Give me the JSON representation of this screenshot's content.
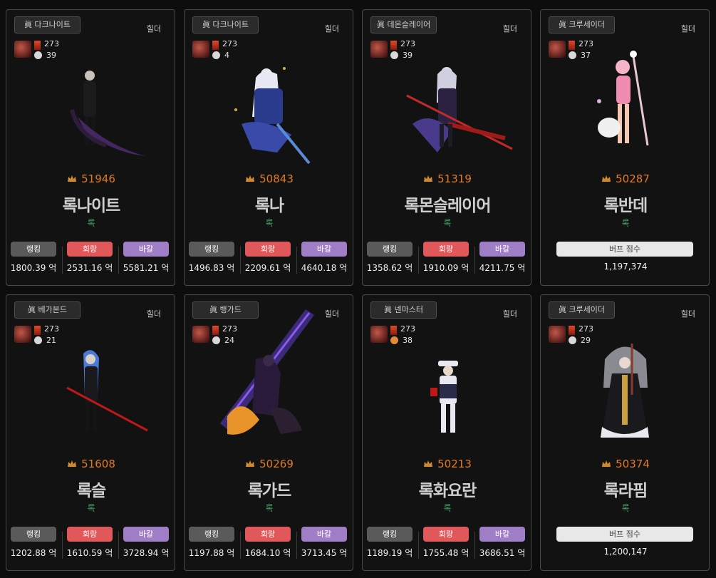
{
  "cards": [
    {
      "job": "眞 다크나이트",
      "server": "힐더",
      "level": "273",
      "sub": "39",
      "power": "51946",
      "name": "록나이트",
      "guild": "록",
      "type": "stat",
      "ranking": "1800.39 억",
      "hoeryang": "2531.16 억",
      "barkal": "5581.21 억"
    },
    {
      "job": "眞 다크나이트",
      "server": "힐더",
      "level": "273",
      "sub": "4",
      "power": "50843",
      "name": "록나",
      "guild": "록",
      "type": "stat",
      "ranking": "1496.83 억",
      "hoeryang": "2209.61 억",
      "barkal": "4640.18 억"
    },
    {
      "job": "眞 데몬슬레이어",
      "server": "힐더",
      "level": "273",
      "sub": "39",
      "power": "51319",
      "name": "록몬슬레이어",
      "guild": "록",
      "type": "stat",
      "ranking": "1358.62 억",
      "hoeryang": "1910.09 억",
      "barkal": "4211.75 억"
    },
    {
      "job": "眞 크루세이더",
      "server": "힐더",
      "level": "273",
      "sub": "37",
      "power": "50287",
      "name": "록반데",
      "guild": "록",
      "type": "buff",
      "buff_score": "1,197,374"
    },
    {
      "job": "眞 베가본드",
      "server": "힐더",
      "level": "273",
      "sub": "21",
      "power": "51608",
      "name": "록슬",
      "guild": "록",
      "type": "stat",
      "ranking": "1202.88 억",
      "hoeryang": "1610.59 억",
      "barkal": "3728.94 억"
    },
    {
      "job": "眞 뱅가드",
      "server": "힐더",
      "level": "273",
      "sub": "24",
      "power": "50269",
      "name": "록가드",
      "guild": "록",
      "type": "stat",
      "ranking": "1197.88 억",
      "hoeryang": "1684.10 억",
      "barkal": "3713.45 억"
    },
    {
      "job": "眞 넨마스터",
      "server": "힐더",
      "level": "273",
      "sub": "38",
      "power": "50213",
      "name": "록화요란",
      "guild": "록",
      "type": "stat",
      "ranking": "1189.19 억",
      "hoeryang": "1755.48 억",
      "barkal": "3686.51 억"
    },
    {
      "job": "眞 크루세이더",
      "server": "힐더",
      "level": "273",
      "sub": "29",
      "power": "50374",
      "name": "록라핌",
      "guild": "록",
      "type": "buff",
      "buff_score": "1,200,147"
    }
  ],
  "labels": {
    "ranking": "랭킹",
    "hoeryang": "회랑",
    "barkal": "바칼",
    "buff": "버프 점수"
  },
  "colors": {
    "power": "#e07a2a",
    "guild": "#3fa06a",
    "ranking": "#5a5a5a",
    "hoeryang": "#e0585a",
    "barkal": "#a07ec7"
  }
}
